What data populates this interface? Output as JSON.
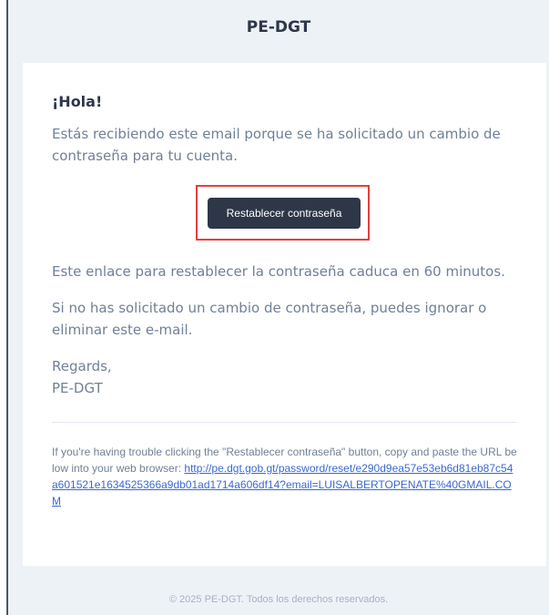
{
  "header": {
    "title": "PE-DGT"
  },
  "email": {
    "greeting": "¡Hola!",
    "intro": "Estás recibiendo este email porque se ha solicitado un cambio de contraseña para tu cuenta.",
    "button_label": "Restablecer contraseña",
    "expiry": "Este enlace para restablecer la contraseña caduca en 60 minutos.",
    "ignore": "Si no has solicitado un cambio de contraseña, puedes ignorar o eliminar este e-mail.",
    "regards": "Regards,",
    "signature": "PE-DGT",
    "trouble_text": "If you're having trouble clicking the \"Restablecer contraseña\" button, copy and paste the URL below into your web browser: ",
    "reset_url": "http://pe.dgt.gob.gt/password/reset/e290d9ea57e53eb6d81eb87c54a601521e1634525366a9db01ad1714a606df14?email=LUISALBERTOPENATE%40GMAIL.COM"
  },
  "footer": {
    "copyright": "© 2025 PE-DGT. Todos los derechos reservados."
  },
  "colors": {
    "button_bg": "#2d3748",
    "highlight_border": "#e53e3e",
    "link": "#3869d4",
    "text_muted": "#718096"
  }
}
